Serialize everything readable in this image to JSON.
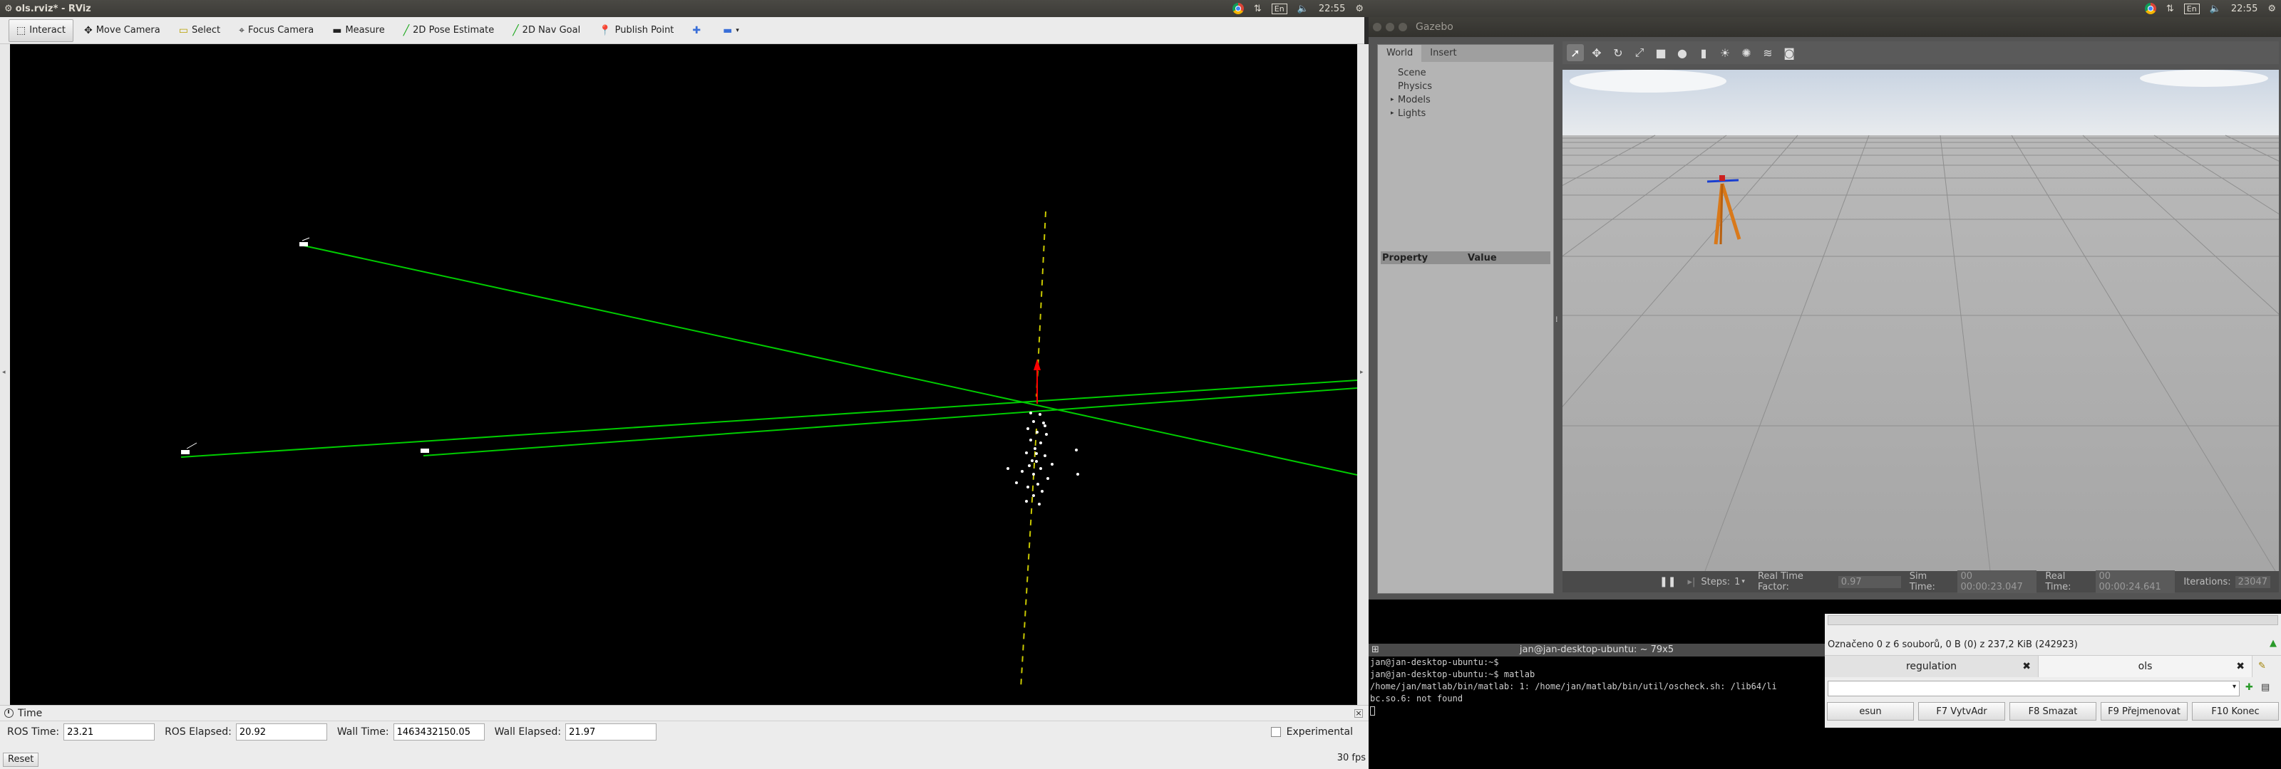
{
  "rviz": {
    "window_title": "ols.rviz* - RViz",
    "tools": [
      {
        "label": "Interact",
        "icon": "interact-icon"
      },
      {
        "label": "Move Camera",
        "icon": "move-camera-icon"
      },
      {
        "label": "Select",
        "icon": "select-icon"
      },
      {
        "label": "Focus Camera",
        "icon": "focus-camera-icon"
      },
      {
        "label": "Measure",
        "icon": "measure-icon"
      },
      {
        "label": "2D Pose Estimate",
        "icon": "pose-estimate-icon"
      },
      {
        "label": "2D Nav Goal",
        "icon": "nav-goal-icon"
      },
      {
        "label": "Publish Point",
        "icon": "publish-point-icon"
      }
    ],
    "time_panel": {
      "title": "Time",
      "ros_time_label": "ROS Time:",
      "ros_time": "23.21",
      "ros_elapsed_label": "ROS Elapsed:",
      "ros_elapsed": "20.92",
      "wall_time_label": "Wall Time:",
      "wall_time": "1463432150.05",
      "wall_elapsed_label": "Wall Elapsed:",
      "wall_elapsed": "21.97",
      "experimental_label": "Experimental",
      "reset_label": "Reset",
      "fps": "30 fps"
    },
    "colors": {
      "path_line": "#00cc00",
      "arrow": "#ff0000",
      "axis": "#c8c800",
      "points": "#ffffff"
    }
  },
  "panel": {
    "clock_left": "22:55",
    "clock_right": "22:55",
    "lang": "En"
  },
  "gazebo": {
    "window_title": "Gazebo",
    "tabs": [
      "World",
      "Insert"
    ],
    "tree": [
      "Scene",
      "Physics",
      "Models",
      "Lights"
    ],
    "property_header": "Property",
    "value_header": "Value",
    "steps_label": "Steps:",
    "steps_value": "1",
    "rtf_label": "Real Time Factor:",
    "rtf_value": "0.97",
    "sim_time_label": "Sim Time:",
    "sim_time_value": "00 00:00:23.047",
    "real_time_label": "Real Time:",
    "real_time_value": "00 00:00:24.641",
    "iterations_label": "Iterations:",
    "iterations_value": "23047"
  },
  "terminal": {
    "title": "jan@jan-desktop-ubuntu: ~ 79x5",
    "lines": [
      "jan@jan-desktop-ubuntu:~$",
      "jan@jan-desktop-ubuntu:~$ matlab",
      "/home/jan/matlab/bin/matlab: 1: /home/jan/matlab/bin/util/oscheck.sh: /lib64/li",
      "bc.so.6: not found"
    ]
  },
  "file_manager": {
    "status": "Označeno 0 z 6 souborů, 0 B  (0) z 237,2 KiB (242923)",
    "tabs": [
      "regulation",
      "ols"
    ],
    "fkeys": [
      "esun",
      "F7 VytvAdr",
      "F8 Smazat",
      "F9 Přejmenovat",
      "F10 Konec"
    ]
  }
}
